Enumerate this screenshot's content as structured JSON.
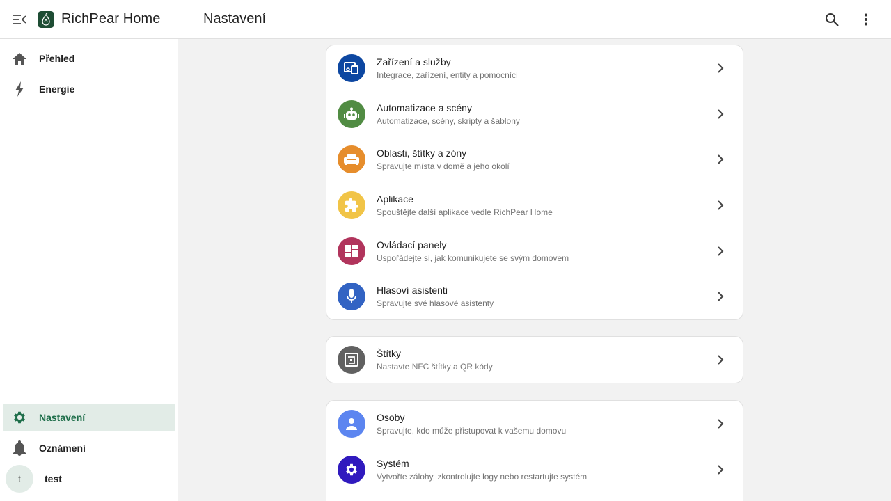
{
  "app": {
    "title": "RichPear Home"
  },
  "header": {
    "title": "Nastavení"
  },
  "sidebar": {
    "items": [
      {
        "label": "Přehled",
        "icon": "home-icon"
      },
      {
        "label": "Energie",
        "icon": "lightning-icon"
      }
    ],
    "bottom": [
      {
        "label": "Nastavení",
        "icon": "gear-icon",
        "active": true
      },
      {
        "label": "Oznámení",
        "icon": "bell-icon"
      }
    ],
    "user": {
      "initial": "t",
      "name": "test"
    }
  },
  "colors": {
    "accent": "#1e6e4a",
    "active_bg": "#e2ece7"
  },
  "sections": [
    {
      "rows": [
        {
          "title": "Zařízení a služby",
          "subtitle": "Integrace, zařízení, entity a pomocníci",
          "icon": "devices-icon",
          "color": "#0d47a1"
        },
        {
          "title": "Automatizace a scény",
          "subtitle": "Automatizace, scény, skripty a šablony",
          "icon": "robot-icon",
          "color": "#518c43"
        },
        {
          "title": "Oblasti, štítky a zóny",
          "subtitle": "Spravujte místa v domě a jeho okolí",
          "icon": "sofa-icon",
          "color": "#e68d2c"
        },
        {
          "title": "Aplikace",
          "subtitle": "Spouštějte další aplikace vedle RichPear Home",
          "icon": "puzzle-icon",
          "color": "#f1c447"
        },
        {
          "title": "Ovládací panely",
          "subtitle": "Uspořádejte si, jak komunikujete se svým domovem",
          "icon": "dashboard-icon",
          "color": "#b1345c"
        },
        {
          "title": "Hlasoví asistenti",
          "subtitle": "Spravujte své hlasové asistenty",
          "icon": "microphone-icon",
          "color": "#3263c3"
        }
      ]
    },
    {
      "rows": [
        {
          "title": "Štítky",
          "subtitle": "Nastavte NFC štítky a QR kódy",
          "icon": "nfc-icon",
          "color": "#616161"
        }
      ]
    },
    {
      "rows": [
        {
          "title": "Osoby",
          "subtitle": "Spravujte, kdo může přistupovat k vašemu domovu",
          "icon": "person-icon",
          "color": "#5c85f0"
        },
        {
          "title": "Systém",
          "subtitle": "Vytvořte zálohy, zkontrolujte logy nebo restartujte systém",
          "icon": "system-gear-icon",
          "color": "#301abe"
        }
      ]
    }
  ]
}
